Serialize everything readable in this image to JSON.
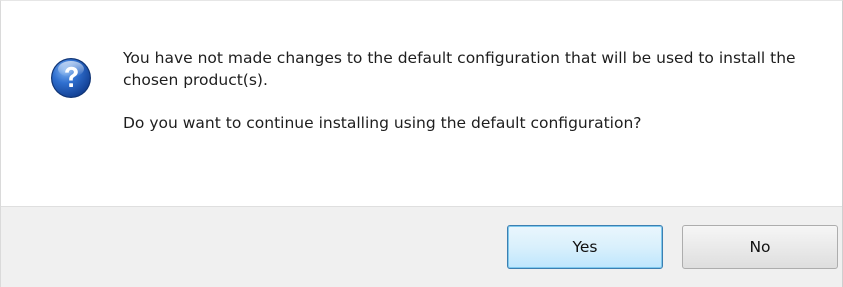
{
  "message": {
    "line1": "You have not made changes to the default configuration that will be used to install the chosen product(s).",
    "line2": "Do you want to continue installing using the default configuration?",
    "icon": "question-icon"
  },
  "buttons": {
    "yes_label": "Yes",
    "no_label": "No"
  },
  "colors": {
    "icon_blue": "#2b66c0",
    "footer_bg": "#f0f0f0",
    "default_button_border": "#3c7fb1"
  }
}
